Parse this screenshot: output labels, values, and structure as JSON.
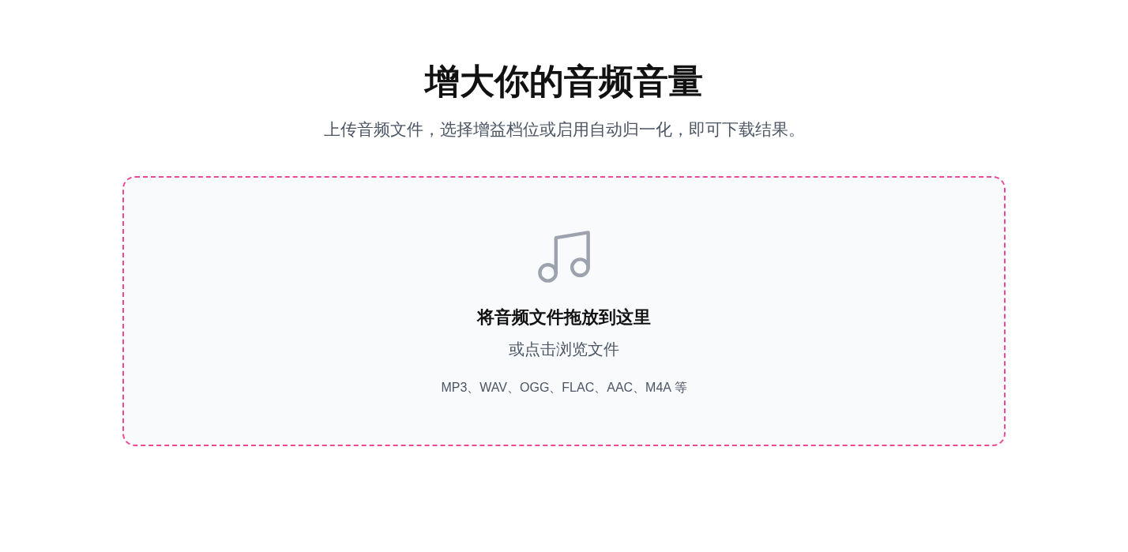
{
  "header": {
    "title": "增大你的音频音量",
    "subtitle": "上传音频文件，选择增益档位或启用自动归一化，即可下载结果。"
  },
  "dropzone": {
    "heading": "将音频文件拖放到这里",
    "browse_hint": "或点击浏览文件",
    "formats": "MP3、WAV、OGG、FLAC、AAC、M4A 等"
  }
}
